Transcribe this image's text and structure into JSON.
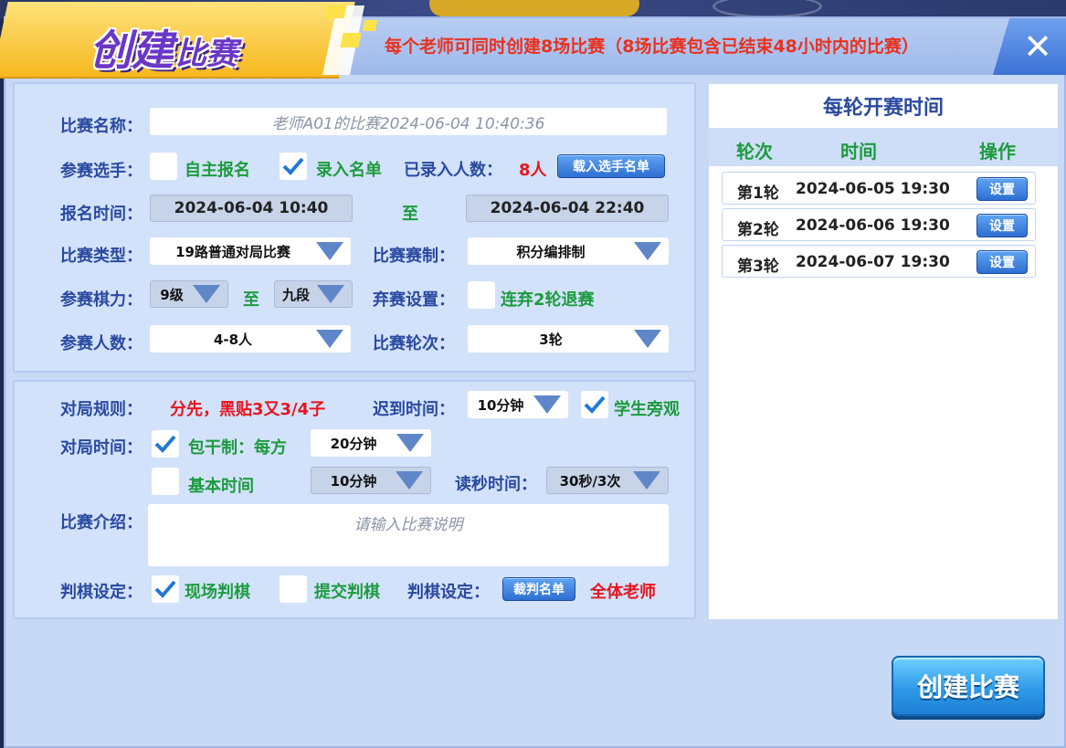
{
  "header": {
    "title_big": "创建",
    "title_small": "比赛",
    "notice": "每个老师可同时创建8场比赛（8场比赛包含已结束48小时内的比赛）",
    "close": "✕"
  },
  "form": {
    "name_label": "比赛名称：",
    "name_value": "老师A01的比赛2024-06-04 10:40:36",
    "players_label": "参赛选手：",
    "self_register": "自主报名",
    "self_register_checked": false,
    "enter_list": "录入名单",
    "enter_list_checked": true,
    "entered_count_label": "已录入人数：",
    "entered_count": "8人",
    "import_button": "载入选手名单",
    "signup_label": "报名时间：",
    "signup_start": "2024-06-04 10:40",
    "to": "至",
    "signup_end": "2024-06-04 22:40",
    "type_label": "比赛类型：",
    "type_value": "19路普通对局比赛",
    "format_label": "比赛赛制：",
    "format_value": "积分编排制",
    "level_label": "参赛棋力：",
    "level_min": "9级",
    "level_max": "九段",
    "forfeit_label": "弃赛设置：",
    "forfeit_text": "连弃2轮退赛",
    "forfeit_checked": false,
    "count_label": "参赛人数：",
    "count_value": "4-8人",
    "rounds_label": "比赛轮次：",
    "rounds_value": "3轮",
    "rules_label": "对局规则：",
    "rules_value": "分先，黑贴3又3/4子",
    "late_label": "迟到时间：",
    "late_value": "10分钟",
    "spectate_text": "学生旁观",
    "spectate_checked": true,
    "time_label": "对局时间：",
    "package_text": "包干制：每方",
    "package_checked": true,
    "package_value": "20分钟",
    "basic_text": "基本时间",
    "basic_checked": false,
    "basic_value": "10分钟",
    "byoyomi_label": "读秒时间：",
    "byoyomi_value": "30秒/3次",
    "intro_label": "比赛介绍：",
    "intro_placeholder": "请输入比赛说明",
    "judge_label": "判棋设定：",
    "onsite_text": "现场判棋",
    "onsite_checked": true,
    "submit_text": "提交判棋",
    "submit_checked": false,
    "judge_label2": "判棋设定：",
    "referee_button": "裁判名单",
    "referee_value": "全体老师"
  },
  "schedule": {
    "title": "每轮开赛时间",
    "col_round": "轮次",
    "col_time": "时间",
    "col_action": "操作",
    "rounds": [
      {
        "round": "第1轮",
        "time": "2024-06-05 19:30",
        "action": "设置"
      },
      {
        "round": "第2轮",
        "time": "2024-06-06 19:30",
        "action": "设置"
      },
      {
        "round": "第3轮",
        "time": "2024-06-07 19:30",
        "action": "设置"
      }
    ]
  },
  "create_button": "创建比赛",
  "colors": {
    "label_blue": "#2a4aa0",
    "green": "#1d9b3e",
    "red": "#e8141d",
    "panel": "#d3e2fb"
  }
}
